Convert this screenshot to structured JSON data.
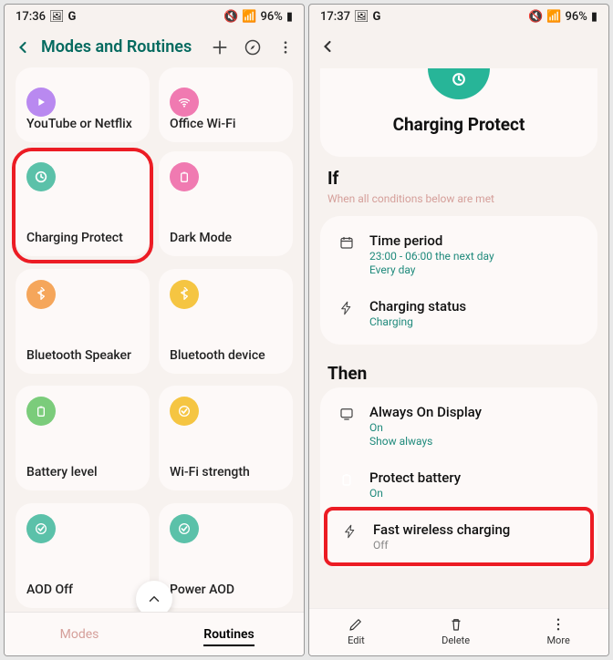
{
  "left": {
    "status": {
      "time": "17:36",
      "battery": "96%"
    },
    "header": {
      "title": "Modes and Routines"
    },
    "cards": [
      {
        "label": "YouTube or Netflix",
        "color": "#b989f0",
        "icon": "play"
      },
      {
        "label": "Office Wi-Fi",
        "color": "#f07ab1",
        "icon": "wifi"
      },
      {
        "label": "Charging Protect",
        "color": "#5bc1a9",
        "icon": "clock",
        "highlight": true
      },
      {
        "label": "Dark Mode",
        "color": "#f07ab1",
        "icon": "battery"
      },
      {
        "label": "Bluetooth Speaker",
        "color": "#f5a65b",
        "icon": "bluetooth"
      },
      {
        "label": "Bluetooth device",
        "color": "#f5c542",
        "icon": "bluetooth"
      },
      {
        "label": "Battery level",
        "color": "#7bcc7b",
        "icon": "battery"
      },
      {
        "label": "Wi-Fi strength",
        "color": "#f5c542",
        "icon": "check"
      },
      {
        "label": "AOD Off",
        "color": "#5bc1a9",
        "icon": "check"
      },
      {
        "label": "Power AOD",
        "color": "#5bc1a9",
        "icon": "check"
      }
    ],
    "tabs": {
      "modes": "Modes",
      "routines": "Routines"
    }
  },
  "right": {
    "status": {
      "time": "17:37",
      "battery": "96%"
    },
    "hero": {
      "title": "Charging Protect"
    },
    "if": {
      "title": "If",
      "subtitle": "When all conditions below are met",
      "items": [
        {
          "icon": "calendar",
          "title": "Time period",
          "line1": "23:00 - 06:00 the next day",
          "line2": "Every day"
        },
        {
          "icon": "bolt",
          "title": "Charging status",
          "line1": "Charging"
        }
      ]
    },
    "then": {
      "title": "Then",
      "items": [
        {
          "icon": "display",
          "title": "Always On Display",
          "line1": "On",
          "line2": "Show always"
        },
        {
          "icon": "battery",
          "title": "Protect battery",
          "line1": "On"
        },
        {
          "icon": "bolt",
          "title": "Fast wireless charging",
          "line1": "Off",
          "gray": true,
          "highlight": true
        }
      ]
    },
    "actions": {
      "edit": "Edit",
      "delete": "Delete",
      "more": "More"
    }
  }
}
